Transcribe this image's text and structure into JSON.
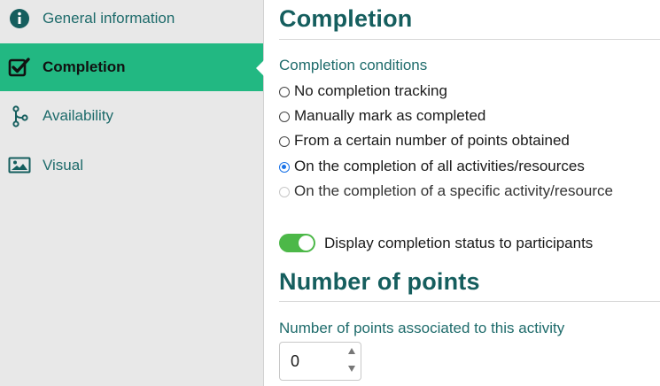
{
  "sidebar": {
    "items": [
      {
        "label": "General information",
        "icon": "info-circle-icon",
        "active": false
      },
      {
        "label": "Completion",
        "icon": "checkbox-checked-icon",
        "active": true
      },
      {
        "label": "Availability",
        "icon": "branch-icon",
        "active": false
      },
      {
        "label": "Visual",
        "icon": "image-icon",
        "active": false
      }
    ]
  },
  "completion": {
    "title": "Completion",
    "conditions_label": "Completion conditions",
    "options": [
      {
        "label": "No completion tracking",
        "checked": false,
        "disabled": false
      },
      {
        "label": "Manually mark as completed",
        "checked": false,
        "disabled": false
      },
      {
        "label": "From a certain number of points obtained",
        "checked": false,
        "disabled": false
      },
      {
        "label": "On the completion of all activities/resources",
        "checked": true,
        "disabled": false
      },
      {
        "label": "On the completion of a specific activity/resource",
        "checked": false,
        "disabled": true
      }
    ],
    "toggle_label": "Display completion status to participants",
    "toggle_on": true
  },
  "points": {
    "title": "Number of points",
    "field_label": "Number of points associated to this activity",
    "value": "0"
  },
  "colors": {
    "accent_green": "#22b882",
    "teal_text": "#1e6b6b",
    "toggle_green": "#4cb848",
    "radio_blue": "#1a73e8"
  }
}
